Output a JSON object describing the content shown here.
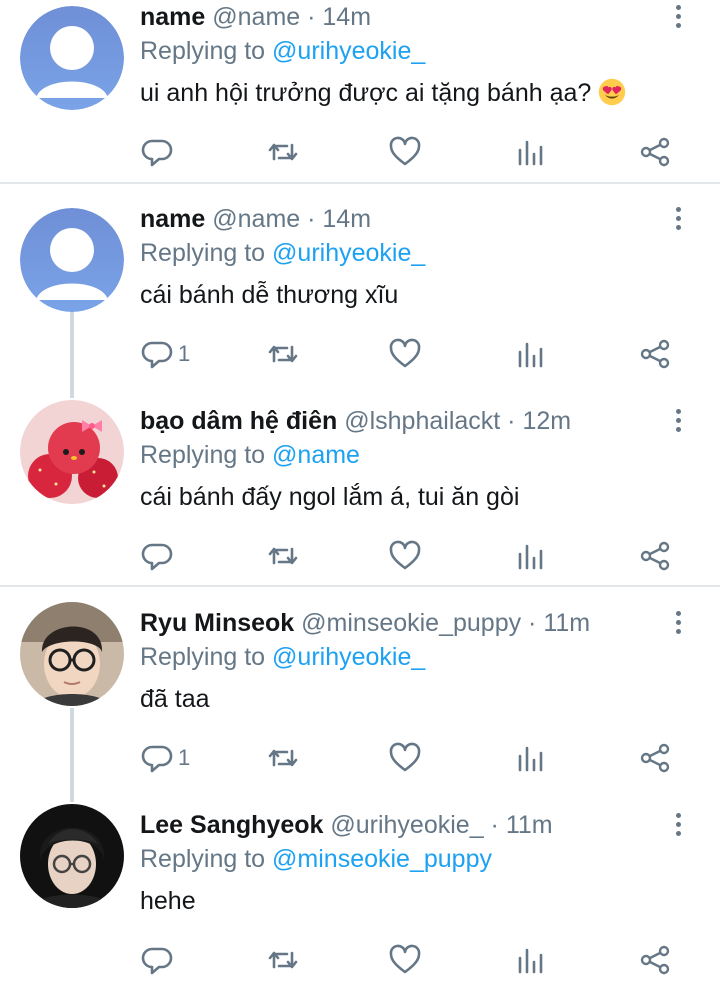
{
  "tweets": [
    {
      "name": "name",
      "handle": "@name",
      "sep": " · ",
      "time": "14m",
      "replying_prefix": "Replying to ",
      "replying_to": "@urihyeokie_",
      "text": "ui anh hội trưởng được ai tặng bánh ạa?",
      "emoji": "smiling-face-with-heart-eyes",
      "reply_count": "",
      "avatar": "default-profile"
    },
    {
      "name": "name",
      "handle": "@name",
      "sep": " · ",
      "time": "14m",
      "replying_prefix": "Replying to ",
      "replying_to": "@urihyeokie_",
      "text": "cái bánh dễ thương xĩu",
      "reply_count": "1",
      "avatar": "default-profile"
    },
    {
      "name": "bạo dâm hệ điên",
      "handle": "@lshphailackt",
      "sep": " · ",
      "time": "12m",
      "replying_prefix": "Replying to ",
      "replying_to": "@name",
      "text": "cái bánh đấy ngol lắm á, tui ăn gòi",
      "reply_count": "",
      "avatar": "strawberry-cake-photo"
    },
    {
      "name": "Ryu Minseok",
      "handle": "@minseokie_puppy",
      "sep": " · ",
      "time": "11m",
      "replying_prefix": "Replying to ",
      "replying_to": "@urihyeokie_",
      "text": "đã taa",
      "reply_count": "1",
      "avatar": "person-photo-glasses"
    },
    {
      "name": "Lee Sanghyeok",
      "handle": "@urihyeokie_",
      "sep": " · ",
      "time": "11m",
      "replying_prefix": "Replying to ",
      "replying_to": "@minseokie_puppy",
      "text": "hehe",
      "reply_count": "",
      "avatar": "person-photo-dark"
    }
  ],
  "colors": {
    "text": "#14171a",
    "muted": "#657786",
    "link": "#1da1f2",
    "divider": "#e3e6e8",
    "thread_line": "#cfd9de",
    "default_avatar": "#6f8fd6"
  },
  "icons": [
    "reply-icon",
    "retweet-icon",
    "like-icon",
    "stats-icon",
    "share-icon",
    "more-options-icon"
  ]
}
